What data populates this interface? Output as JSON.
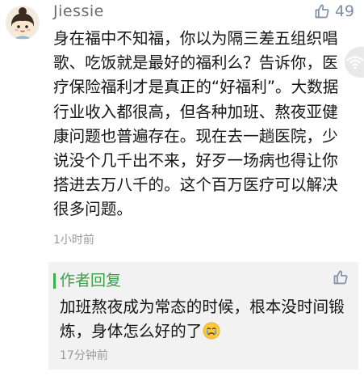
{
  "comment": {
    "username": "Jiessie",
    "avatar_icon": "girl-cartoon-avatar",
    "like_icon": "thumbs-up-icon",
    "like_count": "49",
    "text": "身在福中不知福，你以为隔三差五组织唱歌、吃饭就是最好的福利么？告诉你，医疗保险福利才是真正的“好福利”。大数据行业收入都很高，但各种加班、熬夜亚健康问题也普遍存在。现在去一趟医院，少说没个几千出不来，好歹一场病也得让你搭进去万八千的。这个百万医疗可以解决很多问题。",
    "time": "1小时前"
  },
  "side_indicator": {
    "icon": "wifi-icon"
  },
  "reply": {
    "author": "作者回复",
    "accent_color": "#3cb24a",
    "like_icon": "thumbs-up-icon",
    "text": "加班熬夜成为常态的时候，根本没时间锻炼，身体怎么好的了",
    "emoji_icon": "crying-face-emoji",
    "time": "17分钟前"
  }
}
